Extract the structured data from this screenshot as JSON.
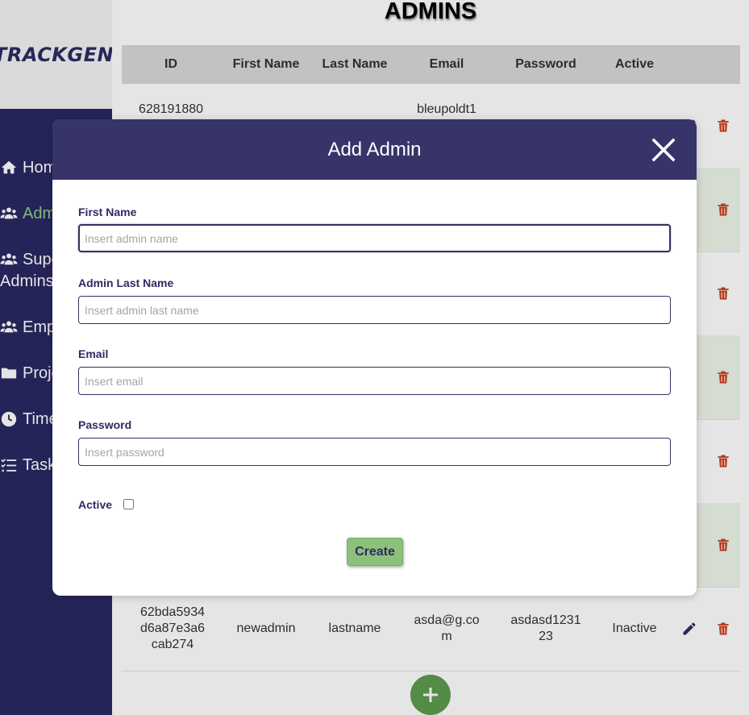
{
  "app": {
    "logo": "TRACKGENIX"
  },
  "sidebar": {
    "items": [
      {
        "label": "Home",
        "icon": "home-icon"
      },
      {
        "label": "Admins",
        "icon": "users-icon",
        "active": true
      },
      {
        "label": "Super Admins",
        "icon": "users-icon"
      },
      {
        "label": "Employees",
        "icon": "users-icon"
      },
      {
        "label": "Projects",
        "icon": "folder-icon"
      },
      {
        "label": "Time Sheets",
        "icon": "clock-icon"
      },
      {
        "label": "Tasks",
        "icon": "tasks-icon"
      }
    ]
  },
  "page": {
    "title": "ADMINS"
  },
  "table": {
    "columns": [
      "ID",
      "First Name",
      "Last Name",
      "Email",
      "Password",
      "Active"
    ],
    "rows": [
      {
        "id": "628191880",
        "first_name": "",
        "last_name": "",
        "email": "bleupoldt1",
        "password": "",
        "active": ""
      },
      {
        "id": "",
        "first_name": "",
        "last_name": "",
        "email": "",
        "password": "",
        "active": ""
      },
      {
        "id": "",
        "first_name": "",
        "last_name": "",
        "email": "",
        "password": "",
        "active": ""
      },
      {
        "id": "",
        "first_name": "",
        "last_name": "",
        "email": "",
        "password": "",
        "active": ""
      },
      {
        "id": "",
        "first_name": "",
        "last_name": "",
        "email": "",
        "password": "",
        "active": ""
      },
      {
        "id": "",
        "first_name": "",
        "last_name": "",
        "email": "",
        "password": "",
        "active": ""
      },
      {
        "id": "62bda5934d6a87e3a6cab274",
        "first_name": "newadmin",
        "last_name": "lastname",
        "email": "asda@g.com",
        "password": "asdasd123123",
        "active": "Inactive"
      }
    ]
  },
  "modal": {
    "title": "Add Admin",
    "fields": {
      "first_name": {
        "label": "First Name",
        "placeholder": "Insert admin name",
        "value": ""
      },
      "last_name": {
        "label": "Admin Last Name",
        "placeholder": "Insert admin last name",
        "value": ""
      },
      "email": {
        "label": "Email",
        "placeholder": "Insert email",
        "value": ""
      },
      "password": {
        "label": "Password",
        "placeholder": "Insert password",
        "value": ""
      }
    },
    "active_label": "Active",
    "active_checked": false,
    "create_label": "Create"
  },
  "colors": {
    "sidebar_bg": "#2a2964",
    "modal_header_bg": "#363468",
    "accent_green": "#8fcf8a",
    "create_button_bg": "#8dc17b",
    "delete_red": "#cc3a1a",
    "fab_green": "#5e9b4f"
  }
}
